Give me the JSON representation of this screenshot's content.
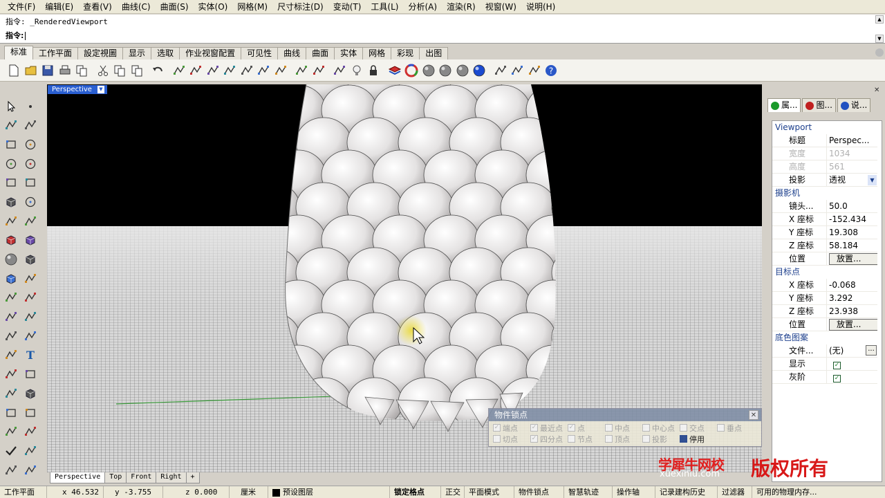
{
  "menu": [
    "文件(F)",
    "编辑(E)",
    "查看(V)",
    "曲线(C)",
    "曲面(S)",
    "实体(O)",
    "网格(M)",
    "尺寸标注(D)",
    "变动(T)",
    "工具(L)",
    "分析(A)",
    "渲染(R)",
    "视窗(W)",
    "说明(H)"
  ],
  "command": {
    "history": "指令: _RenderedViewport",
    "prompt": "指令:"
  },
  "tabs": [
    "标准",
    "工作平面",
    "設定視圖",
    "显示",
    "选取",
    "作业视窗配置",
    "可见性",
    "曲线",
    "曲面",
    "实体",
    "网格",
    "彩现",
    "出图"
  ],
  "active_tab": 0,
  "toolbar_icons": [
    "new-file-icon",
    "open-folder-icon",
    "save-icon",
    "print-icon",
    "import-icon",
    "cut-icon",
    "copy-icon",
    "paste-icon",
    "undo-icon",
    "pan-hand-icon",
    "move-view-icon",
    "zoom-icon",
    "zoom-window-icon",
    "zoom-selected-icon",
    "rotate-view-icon",
    "four-viewports-icon",
    "car-icon",
    "options-icon",
    "snap-icon",
    "lightbulb-icon",
    "lock-icon",
    "layer-icon",
    "color-wheel-icon",
    "wireframe-sphere-icon",
    "shaded-sphere-icon",
    "render-sphere-icon",
    "blue-sphere-icon",
    "render-settings-icon",
    "gear-icon",
    "properties-icon",
    "help-icon"
  ],
  "left_tools": [
    "select-arrow-icon",
    "point-icon",
    "polyline-icon",
    "curve-icon",
    "rectangle-points-icon",
    "circle-icon",
    "ellipse-icon",
    "arc-icon",
    "polygon-icon",
    "rectangle-icon",
    "box-outline-icon",
    "arc-center-icon",
    "fillet-curve-icon",
    "offset-icon",
    "surface-icon",
    "box-solid-icon",
    "sphere-group-icon",
    "cylinder-icon",
    "plane-surface-icon",
    "gear-cog-icon",
    "extrude-icon",
    "explode-icon",
    "join-icon",
    "boolean-icon",
    "group-icon",
    "curve-tool-icon",
    "blend-icon",
    "text-icon",
    "scale-icon",
    "array-icon",
    "pipe-icon",
    "cube-icon",
    "grid-icon",
    "array-grid-icon",
    "cage-icon",
    "shield-icon",
    "check-icon",
    "analyze-icon",
    "render-icon",
    "misc-icon"
  ],
  "viewport": {
    "title": "Perspective",
    "tabs": [
      "Perspective",
      "Top",
      "Front",
      "Right"
    ],
    "active": 0
  },
  "osnap": {
    "title": "物件锁点",
    "options": [
      {
        "label": "端点",
        "checked": true,
        "enabled": false
      },
      {
        "label": "最近点",
        "checked": true,
        "enabled": false
      },
      {
        "label": "点",
        "checked": true,
        "enabled": false
      },
      {
        "label": "中点",
        "checked": false,
        "enabled": false
      },
      {
        "label": "中心点",
        "checked": false,
        "enabled": false
      },
      {
        "label": "交点",
        "checked": false,
        "enabled": false
      },
      {
        "label": "垂点",
        "checked": false,
        "enabled": false
      },
      {
        "label": "切点",
        "checked": false,
        "enabled": false
      },
      {
        "label": "四分点",
        "checked": true,
        "enabled": false
      },
      {
        "label": "节点",
        "checked": false,
        "enabled": false
      },
      {
        "label": "顶点",
        "checked": false,
        "enabled": false
      },
      {
        "label": "投影",
        "checked": false,
        "enabled": false
      },
      {
        "label": "停用",
        "checked": true,
        "enabled": true
      }
    ]
  },
  "right_panel": {
    "tabs": [
      {
        "label": "属...",
        "icon": "properties-icon",
        "color": "#1a9a2a"
      },
      {
        "label": "图...",
        "icon": "layers-icon",
        "color": "#c02020"
      },
      {
        "label": "说...",
        "icon": "help-icon",
        "color": "#2050c0"
      }
    ],
    "viewport_section": "Viewport",
    "rows1": [
      {
        "k": "标题",
        "v": "Perspec...",
        "dis": false
      },
      {
        "k": "宽度",
        "v": "1034",
        "dis": true
      },
      {
        "k": "高度",
        "v": "561",
        "dis": true
      },
      {
        "k": "投影",
        "v": "透视",
        "dis": false,
        "select": true
      }
    ],
    "camera_section": "摄影机",
    "rows2": [
      {
        "k": "镜头...",
        "v": "50.0"
      },
      {
        "k": "X 座标",
        "v": "-152.434"
      },
      {
        "k": "Y 座标",
        "v": "19.308"
      },
      {
        "k": "Z 座标",
        "v": "58.184"
      },
      {
        "k": "位置",
        "v": "放置...",
        "button": true
      }
    ],
    "target_section": "目标点",
    "rows3": [
      {
        "k": "X 座标",
        "v": "-0.068"
      },
      {
        "k": "Y 座标",
        "v": "3.292"
      },
      {
        "k": "Z 座标",
        "v": "23.938"
      },
      {
        "k": "位置",
        "v": "放置...",
        "button": true
      }
    ],
    "wallpaper_section": "底色图案",
    "rows4": [
      {
        "k": "文件...",
        "v": "(无)",
        "small": "..."
      },
      {
        "k": "显示",
        "check": true
      },
      {
        "k": "灰阶",
        "check": true
      }
    ]
  },
  "status": {
    "cplane": "工作平面",
    "x": "x 46.532",
    "y": "y -3.755",
    "z": "z 0.000",
    "unit": "厘米",
    "layer": "预设图层",
    "snap": "锁定格点",
    "ortho": "正交",
    "planar": "平面模式",
    "osnap": "物件锁点",
    "smarttrack": "智慧轨迹",
    "gumball": "操作轴",
    "history": "记录建构历史",
    "filter": "过滤器",
    "memory": "可用的物理内存..."
  },
  "watermark": {
    "line1": "学犀牛网校",
    "line2": "xuexiniu.com",
    "line3": "版权所有"
  }
}
